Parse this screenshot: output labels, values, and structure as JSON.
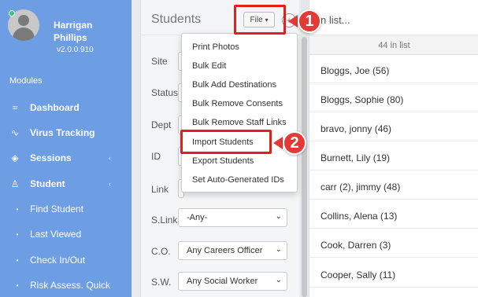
{
  "user": {
    "name": "Harrigan Phillips",
    "version": "v2.0.0.910"
  },
  "sidebar": {
    "modules_label": "Modules",
    "items": [
      {
        "label": "Dashboard",
        "icon": "activity-icon",
        "glyph": "≈"
      },
      {
        "label": "Virus Tracking",
        "icon": "pulse-icon",
        "glyph": "∿"
      },
      {
        "label": "Sessions",
        "icon": "layers-icon",
        "glyph": "◈",
        "chevron": "‹"
      },
      {
        "label": "Student",
        "icon": "people-icon",
        "glyph": "♙",
        "chevron": "‹"
      },
      {
        "label": "Find Student",
        "icon": "bullet-icon",
        "glyph": "•"
      },
      {
        "label": "Last Viewed",
        "icon": "bullet-icon",
        "glyph": "•"
      },
      {
        "label": "Check In/Out",
        "icon": "bullet-icon",
        "glyph": "•"
      },
      {
        "label": "Risk Assess. Quick",
        "icon": "bullet-icon",
        "glyph": "•"
      }
    ]
  },
  "main": {
    "title": "Students",
    "file_button": "File",
    "file_caret": "▾",
    "plus": "+",
    "filters": [
      {
        "label": "Site",
        "value": ""
      },
      {
        "label": "Status",
        "value": ""
      },
      {
        "label": "Dept",
        "value": ""
      },
      {
        "label": "ID",
        "value": ""
      },
      {
        "label": "Link",
        "value": ""
      },
      {
        "label": "S.Link",
        "value": "-Any-"
      },
      {
        "label": "C.O.",
        "value": "Any Careers Officer"
      },
      {
        "label": "S.W.",
        "value": "Any Social Worker"
      }
    ]
  },
  "file_menu": {
    "items": [
      "Print Photos",
      "Bulk Edit",
      "Bulk Add Destinations",
      "Bulk Remove Consents",
      "Bulk Remove Staff Links",
      "Import Students",
      "Export Students",
      "Set Auto-Generated IDs"
    ]
  },
  "list": {
    "search_placeholder": "n list...",
    "count": "44 in list",
    "items": [
      "Bloggs, Joe (56)",
      "Bloggs, Sophie (80)",
      "bravo, jonny (46)",
      "Burnett, Lily (19)",
      "carr (2), jimmy (48)",
      "Collins, Alena (13)",
      "Cook, Darren (3)",
      "Cooper, Sally (11)"
    ]
  },
  "callouts": {
    "step1": "1",
    "step2": "2"
  },
  "colors": {
    "sidebar": "#6d9ee3",
    "highlight": "#e02020",
    "badge": "#e53935"
  }
}
